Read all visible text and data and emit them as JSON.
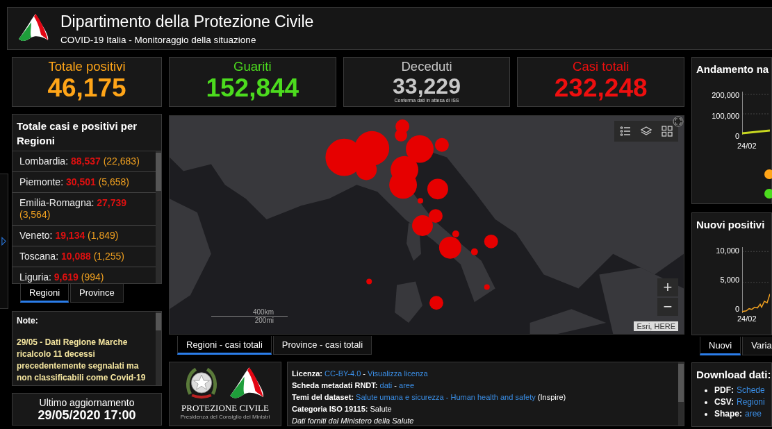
{
  "header": {
    "title": "Dipartimento della Protezione Civile",
    "subtitle": "COVID-19 Italia - Monitoraggio della situazione"
  },
  "stats": [
    {
      "label": "Totale positivi",
      "value": "46,175",
      "color": "#ffa518"
    },
    {
      "label": "Guariti",
      "value": "152,844",
      "color": "#4cdb1e"
    },
    {
      "label": "Deceduti",
      "value": "33,229",
      "color": "#c8c8c8",
      "note": "Conferma dati in attesa di ISS"
    },
    {
      "label": "Casi totali",
      "value": "232,248",
      "color": "#ee0f0f"
    }
  ],
  "regions": {
    "title": "Totale casi e positivi per Regioni",
    "items": [
      {
        "name": "Lombardia:",
        "total": "88,537",
        "positive": "(22,683)"
      },
      {
        "name": "Piemonte:",
        "total": "30,501",
        "positive": "(5,658)"
      },
      {
        "name": "Emilia-Romagna:",
        "total": "27,739",
        "positive": "(3,564)"
      },
      {
        "name": "Veneto:",
        "total": "19,134",
        "positive": "(1,849)"
      },
      {
        "name": "Toscana:",
        "total": "10,088",
        "positive": "(1,255)"
      },
      {
        "name": "Liguria:",
        "total": "9,619",
        "positive": "(994)"
      }
    ],
    "tabs": [
      {
        "label": "Regioni",
        "selected": true
      },
      {
        "label": "Province",
        "selected": false
      }
    ]
  },
  "note": {
    "title": "Note:",
    "text": "29/05 - Dati Regione Marche ricalcolo 11 decessi precedentemente segnalati ma non classificabili come Covid-19"
  },
  "update": {
    "label": "Ultimo aggiornamento",
    "value": "29/05/2020 17:00"
  },
  "map": {
    "scale_km": "400km",
    "scale_mi": "200mi",
    "attribution": "Esri, HERE",
    "zoom_in": "+",
    "zoom_out": "−",
    "tabs": [
      {
        "label": "Regioni - casi totali",
        "selected": true
      },
      {
        "label": "Province - casi totali",
        "selected": false
      }
    ]
  },
  "logo_panel": {
    "name": "PROTEZIONE CIVILE",
    "sub": "Presidenza del Consiglio dei Ministri"
  },
  "info": [
    {
      "label": "Licenza:",
      "kind": "line",
      "parts": [
        {
          "text": "CC-BY-4.0",
          "link": true
        },
        {
          "text": " - ",
          "link": false
        },
        {
          "text": "Visualizza licenza",
          "link": true
        }
      ]
    },
    {
      "label": "Scheda metadati RNDT:",
      "kind": "line",
      "parts": [
        {
          "text": "dati",
          "link": true
        },
        {
          "text": " - ",
          "link": false
        },
        {
          "text": "aree",
          "link": true
        }
      ]
    },
    {
      "label": "Temi del dataset:",
      "kind": "line",
      "parts": [
        {
          "text": "Salute umana e sicurezza - Human health and safety",
          "link": true
        },
        {
          "text": " (Inspire)",
          "link": false
        }
      ]
    },
    {
      "label": "Categoria ISO 19115:",
      "kind": "line",
      "parts": [
        {
          "text": " Salute",
          "link": false
        }
      ]
    },
    {
      "label": "Dati forniti dal Ministero della Salute",
      "kind": "note"
    }
  ],
  "trend": {
    "title": "Andamento na",
    "yticks": [
      "200,000",
      "100,000",
      "0"
    ],
    "xtick": "24/02",
    "legend": [
      {
        "color": "#ffa518"
      },
      {
        "color": "#4cdb1e"
      }
    ]
  },
  "new_cases": {
    "title": "Nuovi positivi",
    "yticks": [
      "10,000",
      "5,000",
      "0"
    ],
    "xtick": "24/02",
    "tabs": [
      {
        "label": "Nuovi",
        "selected": true
      },
      {
        "label": "Varia",
        "selected": false
      }
    ]
  },
  "download": {
    "title": "Download dati:",
    "items": [
      {
        "label": "PDF:",
        "link": "Schede"
      },
      {
        "label": "CSV:",
        "link": "Regioni"
      },
      {
        "label": "Shape:",
        "link": "aree"
      }
    ]
  }
}
